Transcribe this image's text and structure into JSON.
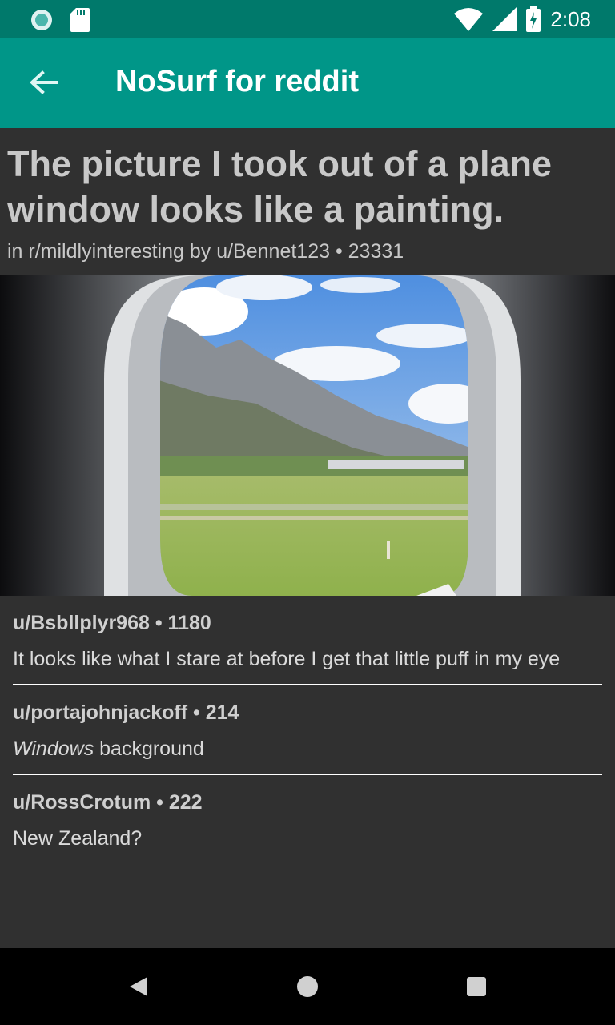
{
  "status_bar": {
    "time": "2:08"
  },
  "app_bar": {
    "title": "NoSurf for reddit"
  },
  "post": {
    "title": "The picture I took out of a plane window looks like a painting.",
    "meta": "in r/mildlyinteresting by u/Bennet123 • 23331"
  },
  "comments": [
    {
      "header": "u/Bsbllplyr968 • 1180",
      "body": "It looks like what I stare at before I get that little puff in my eye"
    },
    {
      "header": "u/portajohnjackoff • 214",
      "body_em": "Windows",
      "body_rest": " background"
    },
    {
      "header": "u/RossCrotum • 222",
      "body": "New Zealand?"
    }
  ],
  "colors": {
    "status_bar": "#00796b",
    "app_bar": "#009688",
    "background": "#303030"
  },
  "icons": [
    "sync-icon",
    "sd-card-icon",
    "wifi-icon",
    "signal-icon",
    "battery-icon",
    "back-arrow-icon",
    "nav-back-icon",
    "nav-home-icon",
    "nav-recents-icon"
  ]
}
